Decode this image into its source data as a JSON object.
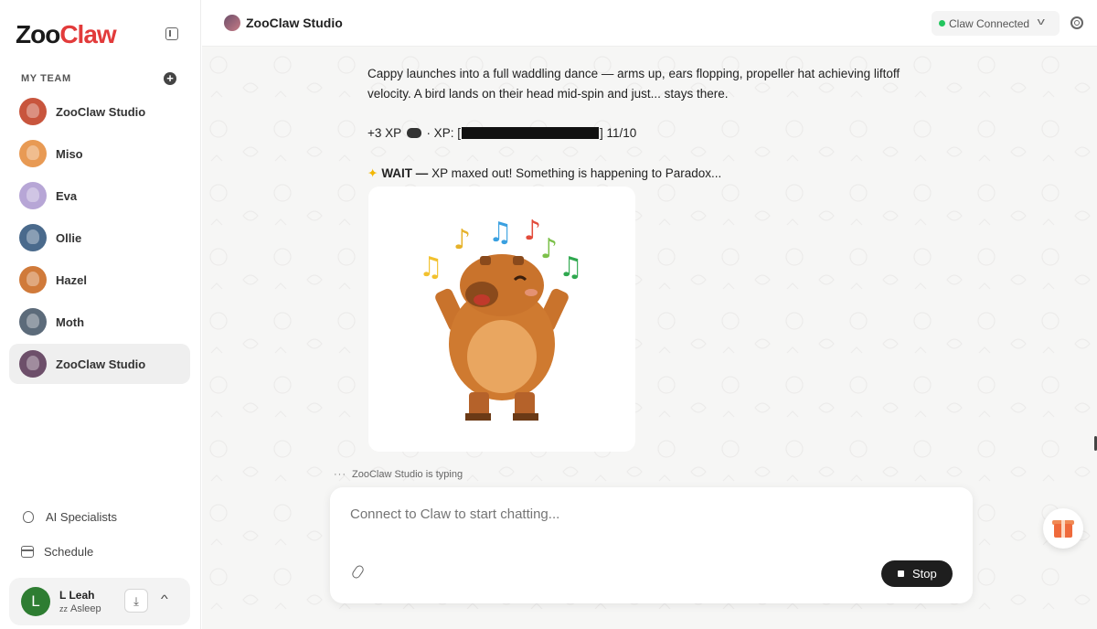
{
  "brand": {
    "zoo": "Zoo",
    "claw": "Claw"
  },
  "sidebar": {
    "team_label": "MY TEAM",
    "team": [
      {
        "name": "ZooClaw Studio",
        "color": "#c8553d",
        "active": false
      },
      {
        "name": "Miso",
        "color": "#e89a54",
        "active": false
      },
      {
        "name": "Eva",
        "color": "#b7a6d6",
        "active": false
      },
      {
        "name": "Ollie",
        "color": "#4a6a8c",
        "active": false
      },
      {
        "name": "Hazel",
        "color": "#d07a3a",
        "active": false
      },
      {
        "name": "Moth",
        "color": "#5c6b7a",
        "active": false
      },
      {
        "name": "ZooClaw Studio",
        "color": "#6d4f6a",
        "active": true
      }
    ],
    "links": {
      "specialists": "AI Specialists",
      "schedule": "Schedule"
    },
    "user": {
      "initial": "L",
      "name": "L Leah",
      "status": "Asleep",
      "status_icon": "zz"
    }
  },
  "header": {
    "title": "ZooClaw Studio",
    "connection_label": "Claw Connected",
    "connection_color": "#22c55e"
  },
  "chat": {
    "p1": "Cappy launches into a full waddling dance — arms up, ears flopping, propeller hat achieving liftoff velocity. A bird lands on their head mid-spin and just... stays there.",
    "xp_prefix": "+3 XP",
    "xp_mid": " · XP: [",
    "xp_suffix": "] 11/10",
    "wait_label": "WAIT —",
    "wait_text": " XP maxed out! Something is happening to Paradox...",
    "typing": "ZooClaw Studio is typing",
    "image_name": "dancing-capybara-with-music-notes"
  },
  "composer": {
    "placeholder": "Connect to Claw to start chatting...",
    "stop_label": "Stop"
  }
}
